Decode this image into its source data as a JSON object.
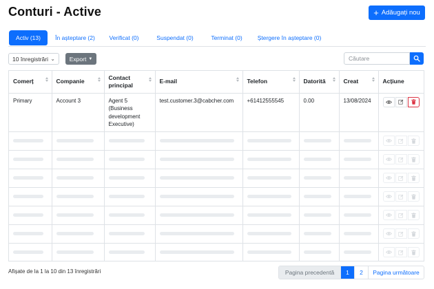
{
  "header": {
    "title": "Conturi - Active",
    "add_button_label": "Adăugați nou",
    "add_icon": "plus-icon"
  },
  "tabs": [
    {
      "label": "Activ (13)",
      "active": true
    },
    {
      "label": "În așteptare (2)",
      "active": false
    },
    {
      "label": "Verificat (0)",
      "active": false
    },
    {
      "label": "Suspendat (0)",
      "active": false
    },
    {
      "label": "Terminat (0)",
      "active": false
    },
    {
      "label": "Ștergere în așteptare (0)",
      "active": false
    }
  ],
  "toolbar": {
    "page_length": "10 înregistrări",
    "export_label": "Export",
    "search_placeholder": "Căutare",
    "search_icon": "search-icon"
  },
  "table": {
    "columns": [
      "Comerț",
      "Companie",
      "Contact principal",
      "E-mail",
      "Telefon",
      "Datorită",
      "Creat",
      "Acțiune"
    ],
    "rows": [
      {
        "comert": "Primary",
        "companie": "Account 3",
        "contact": "Agent 5 (Business development Executive)",
        "email": "test.customer.3@cabcher.com",
        "telefon": "+61412555545",
        "datorita": "0.00",
        "creat": "13/08/2024"
      }
    ],
    "loading_rows": 7,
    "action_icons": [
      "eye-icon",
      "edit-icon",
      "trash-icon"
    ]
  },
  "footer": {
    "info": "Afișate de la 1 la 10 din 13 înregistrări",
    "prev_label": "Pagina precedentă",
    "pages": [
      "1",
      "2"
    ],
    "active_page": "1",
    "next_label": "Pagina următoare"
  },
  "colors": {
    "primary": "#0d6efd",
    "secondary": "#6c757d",
    "danger": "#dc3545",
    "skeleton": "#e9ecef"
  }
}
